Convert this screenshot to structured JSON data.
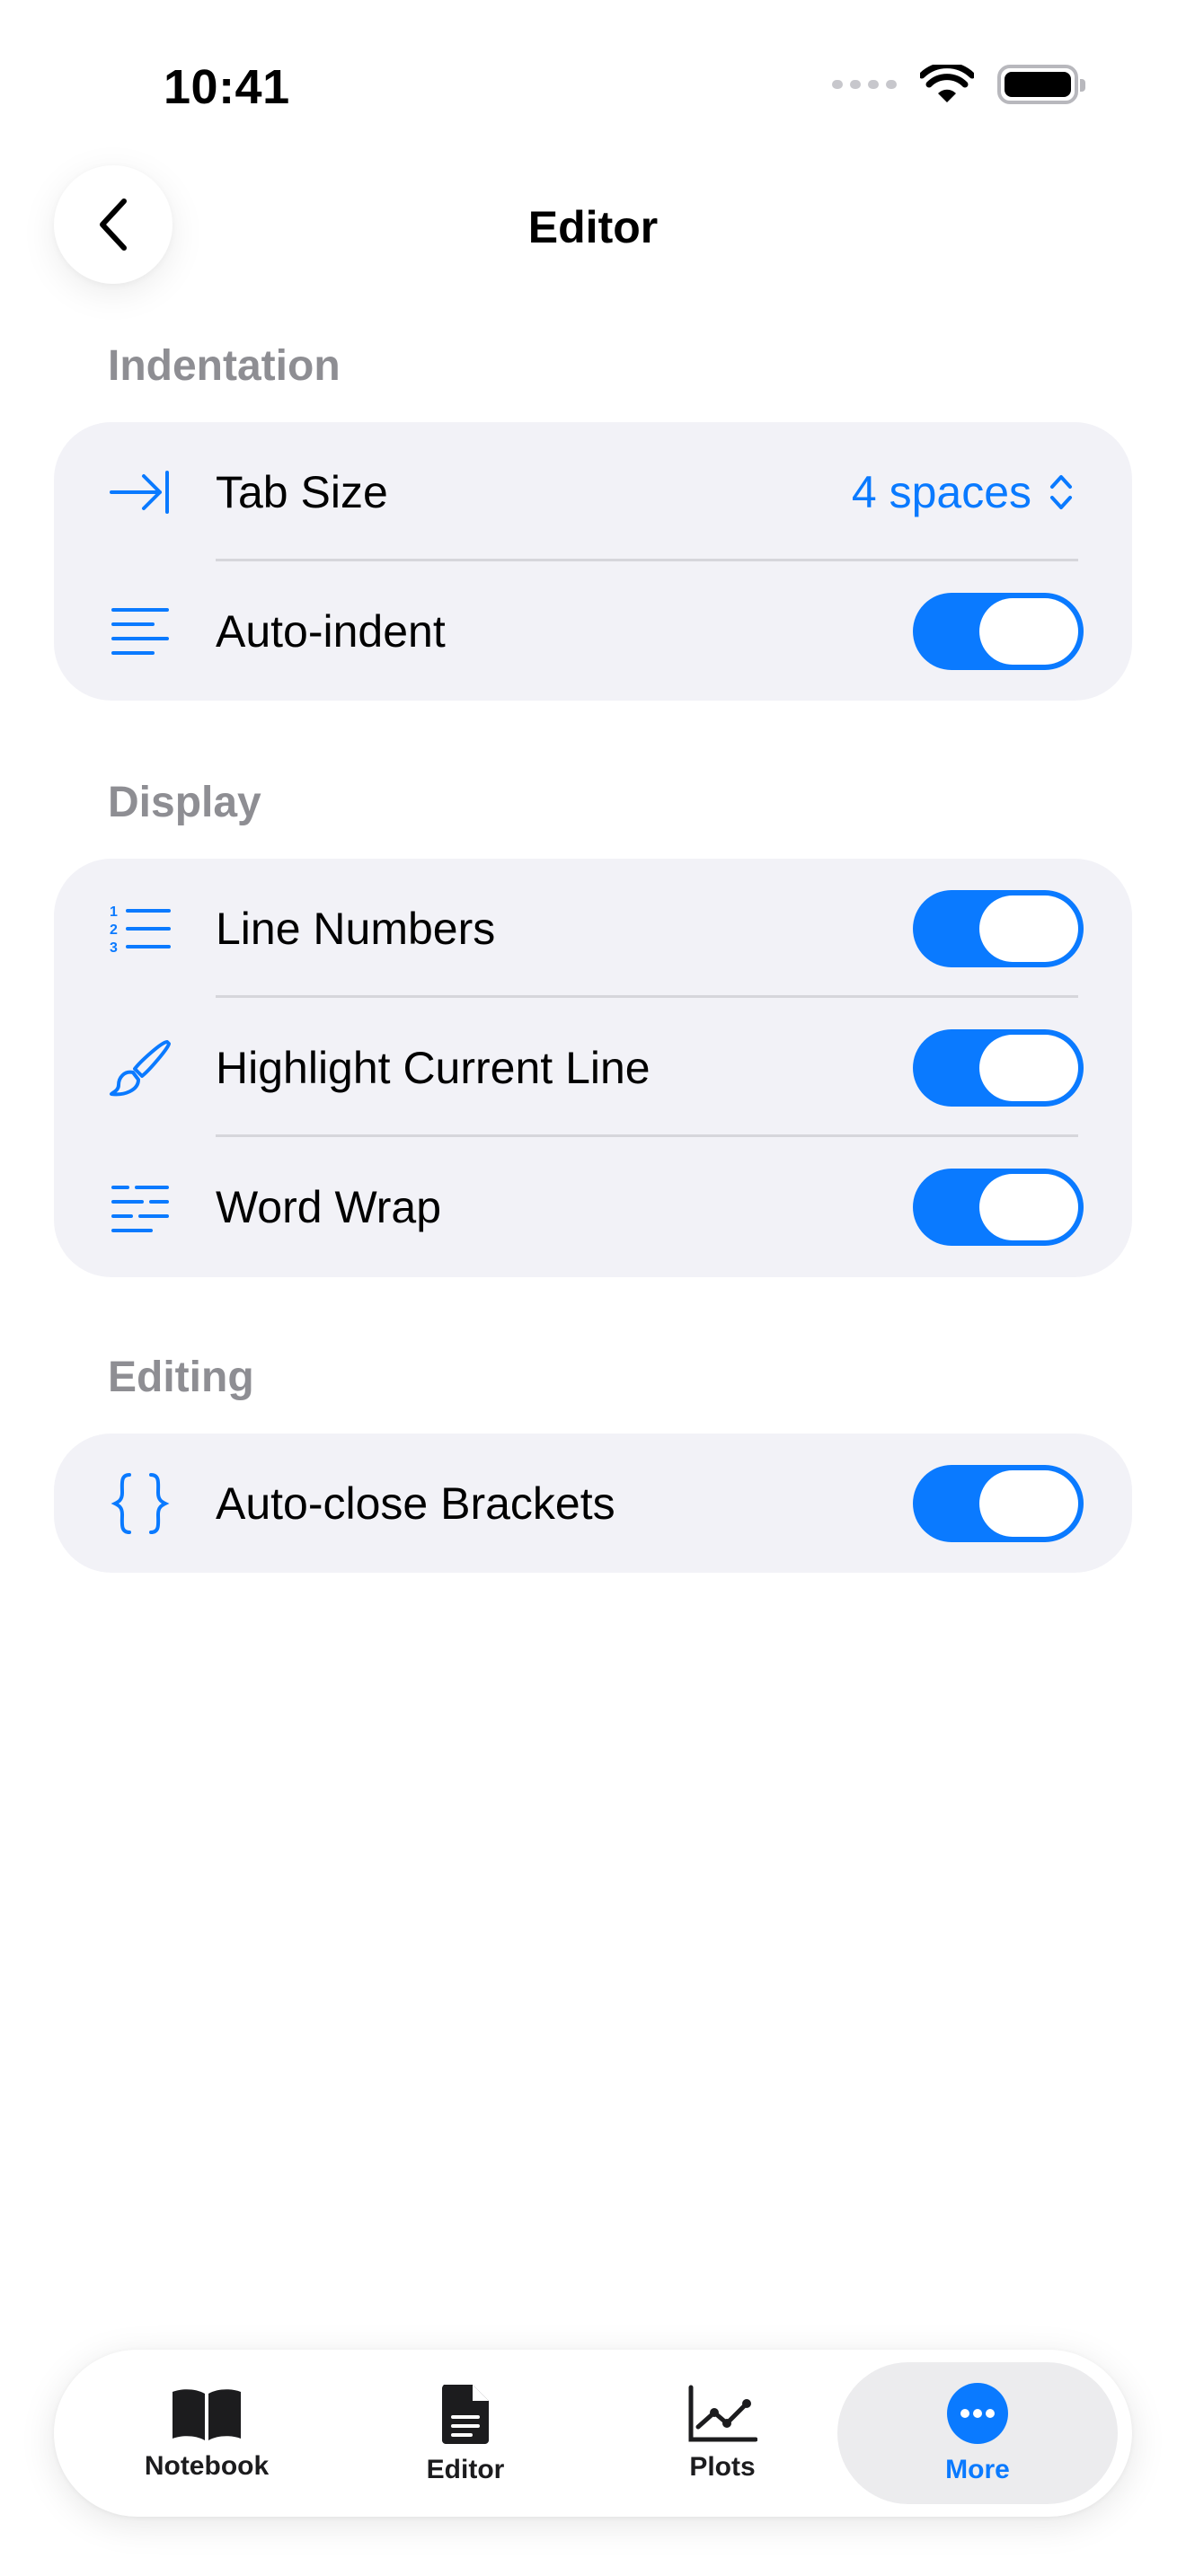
{
  "status_bar": {
    "time": "10:41"
  },
  "nav": {
    "title": "Editor"
  },
  "sections": [
    {
      "header": "Indentation",
      "rows": [
        {
          "label": "Tab Size",
          "icon": "tab-arrow-icon",
          "value": "4 spaces"
        },
        {
          "label": "Auto-indent",
          "icon": "text-align-left-icon",
          "toggle": true
        }
      ]
    },
    {
      "header": "Display",
      "rows": [
        {
          "label": "Line Numbers",
          "icon": "numbered-list-icon",
          "toggle": true
        },
        {
          "label": "Highlight Current Line",
          "icon": "paintbrush-icon",
          "toggle": true
        },
        {
          "label": "Word Wrap",
          "icon": "word-wrap-icon",
          "toggle": true
        }
      ]
    },
    {
      "header": "Editing",
      "rows": [
        {
          "label": "Auto-close Brackets",
          "icon": "curly-braces-icon",
          "toggle": true
        }
      ]
    }
  ],
  "tabbar": {
    "items": [
      {
        "label": "Notebook",
        "icon": "book-icon"
      },
      {
        "label": "Editor",
        "icon": "document-icon"
      },
      {
        "label": "Plots",
        "icon": "line-chart-icon"
      },
      {
        "label": "More",
        "icon": "ellipsis-circle-icon",
        "active": true
      }
    ]
  },
  "colors": {
    "accent": "#0a7aff",
    "group_bg": "#f2f2f7",
    "section_header": "#8e8e93"
  }
}
